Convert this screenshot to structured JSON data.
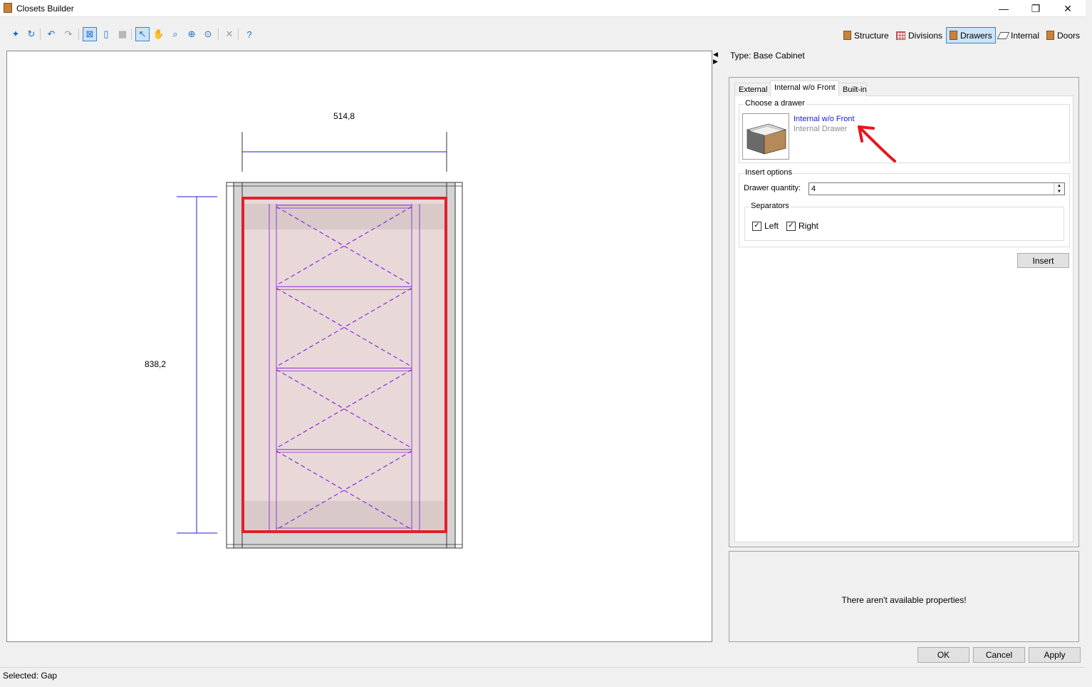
{
  "window": {
    "title": "Closets Builder",
    "minimize": "—",
    "restore": "❐",
    "close": "✕"
  },
  "toolbar": {
    "tools": [
      {
        "name": "new-icon",
        "glyph": "✦"
      },
      {
        "name": "refresh-icon",
        "glyph": "↻"
      },
      {
        "name": "undo-icon",
        "glyph": "↶"
      },
      {
        "name": "redo-icon",
        "glyph": "↷"
      },
      {
        "name": "select-gap-icon",
        "glyph": "⊠"
      },
      {
        "name": "page-icon",
        "glyph": "▯"
      },
      {
        "name": "grid-icon",
        "glyph": "▦"
      },
      {
        "name": "pointer-icon",
        "glyph": "↖"
      },
      {
        "name": "pan-icon",
        "glyph": "✋"
      },
      {
        "name": "zoom-window-icon",
        "glyph": "⌕"
      },
      {
        "name": "zoom-in-icon",
        "glyph": "⊕"
      },
      {
        "name": "zoom-extents-icon",
        "glyph": "⊙"
      },
      {
        "name": "delete-icon",
        "glyph": "✕"
      },
      {
        "name": "help-icon",
        "glyph": "?"
      }
    ],
    "modes": [
      {
        "label": "Structure",
        "icon": "structure-icon"
      },
      {
        "label": "Divisions",
        "icon": "divisions-icon"
      },
      {
        "label": "Drawers",
        "icon": "drawers-icon",
        "active": true
      },
      {
        "label": "Internal",
        "icon": "internal-icon"
      },
      {
        "label": "Doors",
        "icon": "doors-icon"
      }
    ]
  },
  "drawing": {
    "width_dim": "514,8",
    "height_dim": "838,2",
    "drawer_count": 4,
    "colors": {
      "dimension": "#1f1fd0",
      "selection": "#e0202a",
      "drawer": "#8a2be2",
      "fill": "#e9d8d8",
      "panel": "#d4d4d4"
    }
  },
  "panel": {
    "type_label": "Type: Base Cabinet",
    "tabs": [
      {
        "label": "External"
      },
      {
        "label": "Internal w/o Front",
        "selected": true
      },
      {
        "label": "Built-in"
      }
    ],
    "choose_title": "Choose a drawer",
    "drawer": {
      "name": "Internal w/o Front",
      "subtitle": "Internal Drawer",
      "thumbnail": "drawer-thumbnail"
    },
    "insert_options_title": "Insert options",
    "quantity_label": "Drawer quantity:",
    "quantity_value": "4",
    "separators_title": "Separators",
    "sep_left": {
      "label": "Left",
      "checked": true
    },
    "sep_right": {
      "label": "Right",
      "checked": true
    },
    "insert_button": "Insert"
  },
  "properties": {
    "message": "There aren't available properties!"
  },
  "buttons": {
    "ok": "OK",
    "cancel": "Cancel",
    "apply": "Apply"
  },
  "status": {
    "text": "Selected: Gap"
  }
}
